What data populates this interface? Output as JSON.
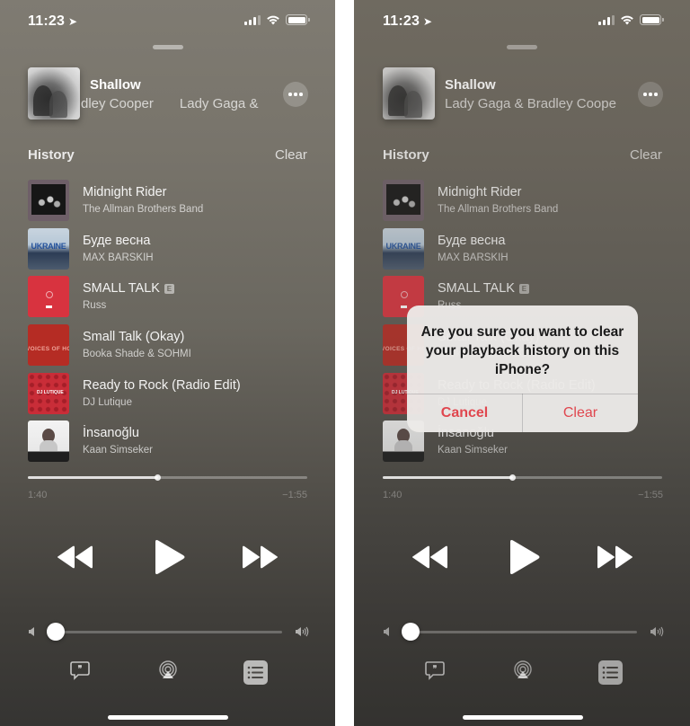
{
  "status_bar": {
    "time": "11:23",
    "location_icon": "location-arrow-icon",
    "signal_icon": "cellular-signal-icon",
    "wifi_icon": "wifi-icon",
    "battery_icon": "battery-icon"
  },
  "now_playing": {
    "title": "Shallow",
    "artist_left_scrolled": "dley Cooper",
    "artist_left_wrap": "Lady Gaga &",
    "artist_full": "Lady Gaga & Bradley Coope",
    "more_icon": "ellipsis-icon"
  },
  "history": {
    "heading": "History",
    "clear_label": "Clear",
    "tracks": [
      {
        "title": "Midnight Rider",
        "artist": "The Allman Brothers Band",
        "explicit": false
      },
      {
        "title": "Буде весна",
        "artist": "MAX BARSKIH",
        "explicit": false
      },
      {
        "title": "SMALL TALK",
        "artist": "Russ",
        "explicit": true
      },
      {
        "title": "Small Talk (Okay)",
        "artist": "Booka Shade & SOHMI",
        "explicit": false
      },
      {
        "title": "Ready to Rock (Radio Edit)",
        "artist": "DJ Lutique",
        "explicit": false
      },
      {
        "title": "İnsanoğlu",
        "artist": "Kaan Simseker",
        "explicit": false
      }
    ],
    "explicit_badge": "E"
  },
  "playback": {
    "elapsed": "1:40",
    "remaining": "−1:55",
    "progress_fraction": 0.465,
    "volume_fraction": 0.0
  },
  "controls": {
    "rewind_icon": "rewind-icon",
    "play_icon": "play-icon",
    "forward_icon": "fast-forward-icon",
    "volume_low_icon": "volume-low-icon",
    "volume_high_icon": "volume-high-icon",
    "lyrics_icon": "lyrics-quote-bubble-icon",
    "airplay_icon": "airplay-icon",
    "queue_icon": "queue-list-icon"
  },
  "dialog": {
    "message": "Are you sure you want to clear your playback history on this iPhone?",
    "cancel_label": "Cancel",
    "confirm_label": "Clear",
    "accent_color": "#e0464e"
  }
}
